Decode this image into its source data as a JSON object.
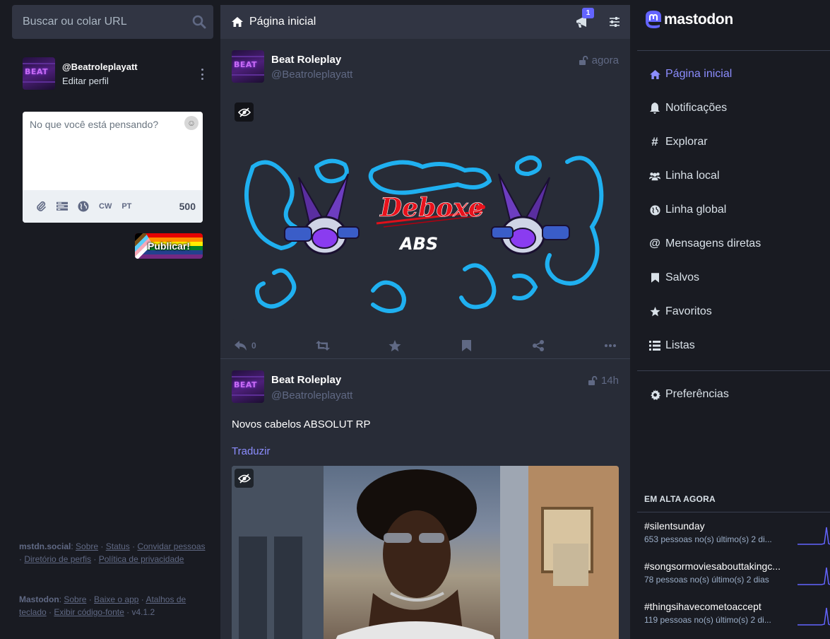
{
  "search": {
    "placeholder": "Buscar ou colar URL"
  },
  "account": {
    "handle": "@Beatroleplayatt",
    "edit_label": "Editar perfil",
    "avatar_text": "BEAT"
  },
  "compose": {
    "placeholder": "No que você está pensando?",
    "cw_label": "CW",
    "lang_label": "PT",
    "char_count": "500",
    "publish_label": "Publicar!"
  },
  "footer": {
    "server": "mstdn.social",
    "server_links": [
      "Sobre",
      "Status",
      "Convidar pessoas",
      "Diretório de perfis",
      "Política de privacidade"
    ],
    "app": "Mastodon",
    "app_links": [
      "Sobre",
      "Baixe o app",
      "Atalhos de teclado",
      "Exibir código-fonte"
    ],
    "version": "v4.1.2"
  },
  "column": {
    "title": "Página inicial",
    "announcement_badge": "1"
  },
  "statuses": [
    {
      "name": "Beat Roleplay",
      "acct": "@Beatroleplayatt",
      "time": "agora",
      "reply_count": "0",
      "image_text": "Deboxe",
      "image_subtext": "ABS"
    },
    {
      "name": "Beat Roleplay",
      "acct": "@Beatroleplayatt",
      "time": "14h",
      "text": "Novos cabelos ABSOLUT RP",
      "translate": "Traduzir"
    }
  ],
  "brand": {
    "name": "mastodon"
  },
  "nav": [
    {
      "label": "Página inicial",
      "icon": "home-icon",
      "active": true
    },
    {
      "label": "Notificações",
      "icon": "bell-icon"
    },
    {
      "label": "Explorar",
      "icon": "hashtag-icon"
    },
    {
      "label": "Linha local",
      "icon": "users-icon"
    },
    {
      "label": "Linha global",
      "icon": "globe-icon"
    },
    {
      "label": "Mensagens diretas",
      "icon": "at-icon"
    },
    {
      "label": "Salvos",
      "icon": "bookmark-icon"
    },
    {
      "label": "Favoritos",
      "icon": "star-icon"
    },
    {
      "label": "Listas",
      "icon": "list-icon"
    },
    {
      "label": "Preferências",
      "icon": "gear-icon"
    }
  ],
  "trends": {
    "heading": "EM ALTA AGORA",
    "items": [
      {
        "tag": "#silentsunday",
        "uses": "653 pessoas no(s) último(s) 2 di..."
      },
      {
        "tag": "#songsormoviesabouttakingc...",
        "uses": "78 pessoas no(s) último(s) 2 dias"
      },
      {
        "tag": "#thingsihavecometoaccept",
        "uses": "119 pessoas no(s) último(s) 2 di..."
      }
    ]
  },
  "colors": {
    "accent": "#8c8dff",
    "brand": "#6364ff",
    "background": "#191b22",
    "column": "#282c37"
  }
}
